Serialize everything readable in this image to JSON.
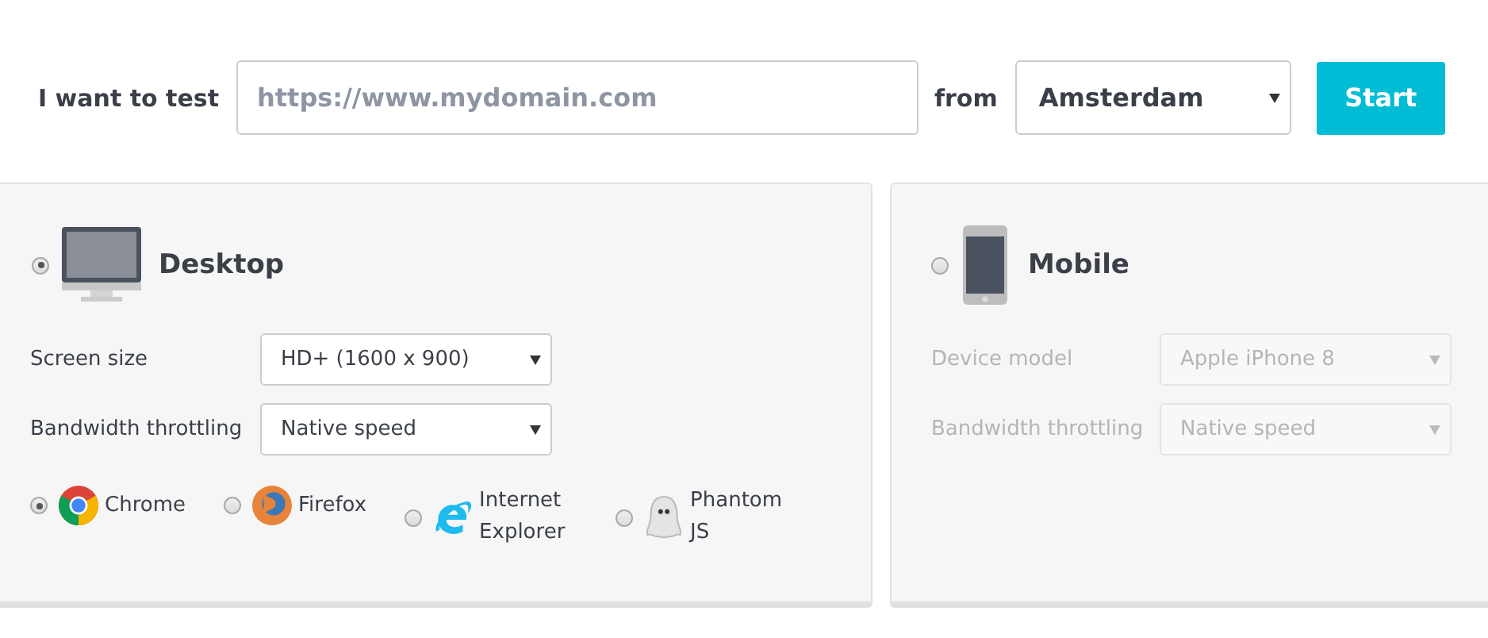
{
  "header": {
    "label": "I want to test",
    "url_field": {
      "placeholder": "https://www.mydomain.com"
    },
    "from_label": "from",
    "location": "Amsterdam",
    "start_button": "Start"
  },
  "platforms": [
    {
      "kind": "desktop",
      "title": "Desktop",
      "selected": true,
      "disabled": false,
      "settings": [
        {
          "label": "Screen size",
          "value": "HD+ (1600 x 900)"
        },
        {
          "label": "Bandwidth throttling",
          "value": "Native speed"
        }
      ],
      "browsers": [
        {
          "kind": "chrome",
          "name": "Chrome",
          "selected": true
        },
        {
          "kind": "firefox",
          "name": "Firefox",
          "selected": false
        },
        {
          "kind": "ie",
          "name": "Internet Explorer",
          "selected": false
        },
        {
          "kind": "phantom",
          "name": "Phantom JS",
          "selected": false
        }
      ]
    },
    {
      "kind": "mobile",
      "title": "Mobile",
      "selected": false,
      "disabled": true,
      "settings": [
        {
          "label": "Device model",
          "value": "Apple iPhone 8"
        },
        {
          "label": "Bandwidth throttling",
          "value": "Native speed"
        }
      ]
    }
  ]
}
